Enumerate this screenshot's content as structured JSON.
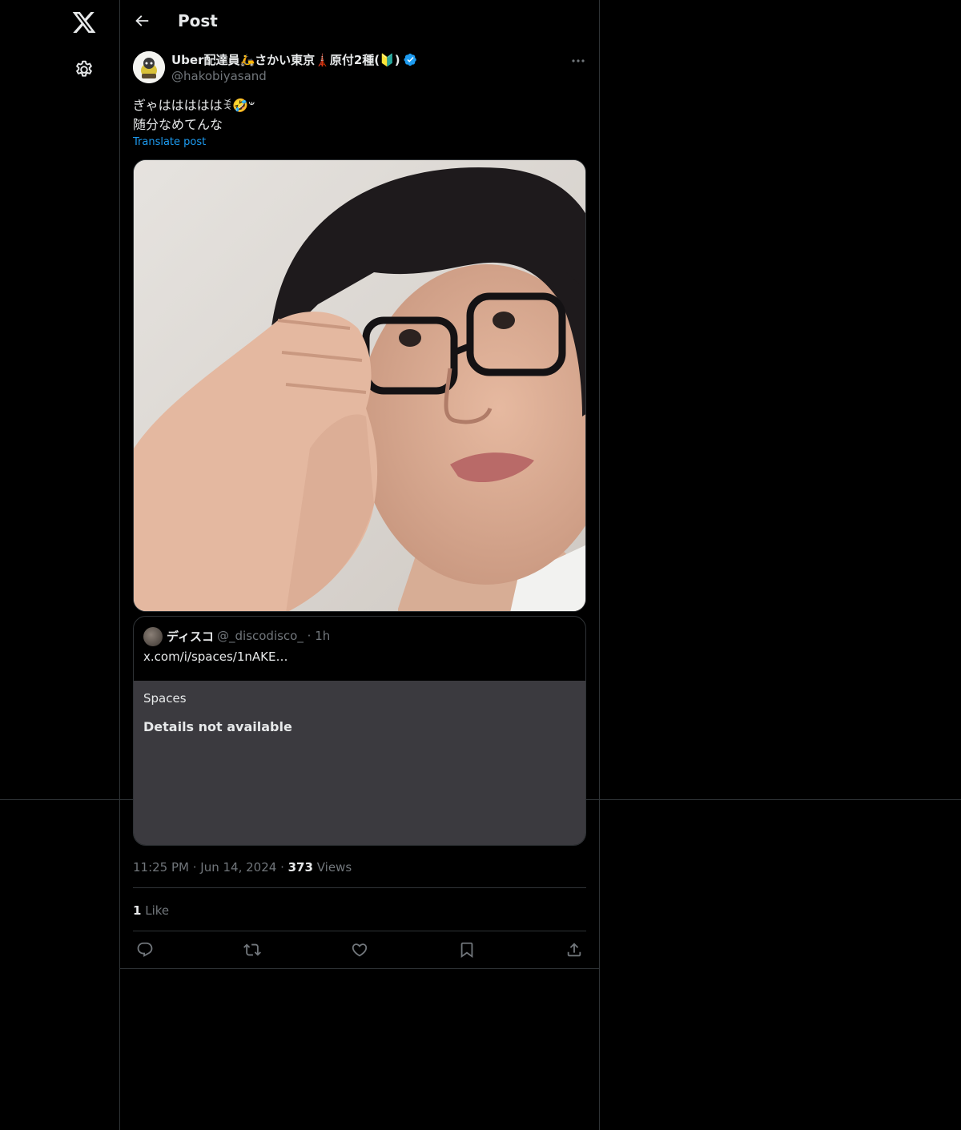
{
  "nav": {
    "logo_icon": "x-logo-icon",
    "settings_icon": "gear-icon"
  },
  "header": {
    "title": "Post"
  },
  "post": {
    "author_name": "Uber配達員🛵さかい東京🗼原付2種(🔰)",
    "handle": "@hakobiyasand",
    "text_line1": "ぎゃはははははꉂ🤣𐤔",
    "text_line2": "随分なめてんな",
    "translate_label": "Translate post",
    "time": "11:25 PM",
    "date": "Jun 14, 2024",
    "views_count": "373",
    "views_label": "Views",
    "likes_count": "1",
    "likes_label": "Like"
  },
  "quote": {
    "name": "ディスコ",
    "handle": "@_discodisco_",
    "dot": "·",
    "age": "1h",
    "link": "x.com/i/spaces/1nAKE…",
    "card_label": "Spaces",
    "card_title": "Details not available"
  },
  "colors": {
    "accent": "#1d9bf0",
    "muted": "#71767b",
    "text": "#e7e9ea",
    "border": "#2f3336",
    "card_bg": "#3b3a3f"
  }
}
